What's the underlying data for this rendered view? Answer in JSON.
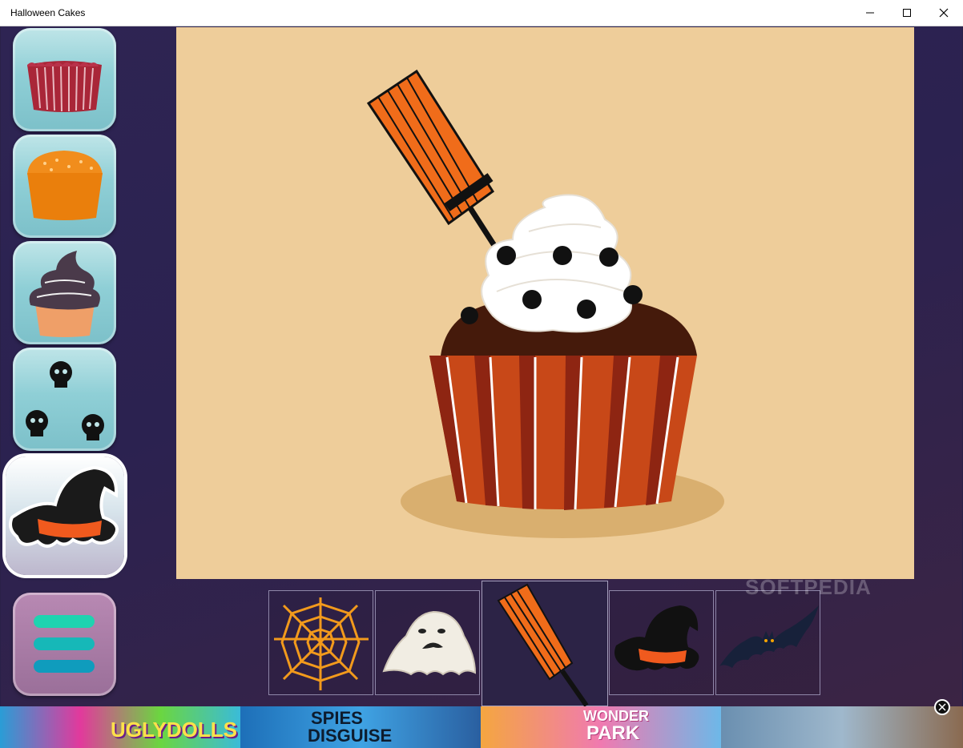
{
  "window": {
    "title": "Halloween Cakes",
    "controls": [
      "minimize-icon",
      "maximize-icon",
      "close-icon"
    ]
  },
  "tools": [
    {
      "name": "cupcake-liner",
      "icon": "liner-icon",
      "selected": false
    },
    {
      "name": "cake-base",
      "icon": "muffin-icon",
      "selected": false
    },
    {
      "name": "frosting",
      "icon": "frosting-icon",
      "selected": false
    },
    {
      "name": "sprinkles",
      "icon": "skulls-icon",
      "selected": false
    },
    {
      "name": "toppers",
      "icon": "witch-hat-icon",
      "selected": true
    }
  ],
  "menu": {
    "icon": "hamburger-icon",
    "colors": [
      "#1fd3b0",
      "#16b8b8",
      "#0f9cbd"
    ]
  },
  "toppers": [
    {
      "name": "spider-web",
      "icon": "spider-web-icon",
      "selected": false
    },
    {
      "name": "ghost",
      "icon": "ghost-icon",
      "selected": false
    },
    {
      "name": "broom",
      "icon": "broom-icon",
      "selected": true
    },
    {
      "name": "witch-hat",
      "icon": "witch-hat-icon",
      "selected": false
    },
    {
      "name": "bat",
      "icon": "bat-icon",
      "selected": false
    }
  ],
  "watermark": "SOFTPEDIA",
  "ads": [
    {
      "text": "UGLYDOLLS"
    },
    {
      "text_top": "SPIES",
      "text_bottom": "DISGUISE"
    },
    {
      "text_top": "WONDER",
      "text_bottom": "PARK"
    },
    {
      "text": ""
    }
  ],
  "colors": {
    "canvas_bg": "#eecd9a",
    "liner_orange": "#c84818",
    "liner_red": "#8e2512",
    "chocolate": "#451a0b",
    "frosting": "#ffffff",
    "broom_orange": "#f06c1a"
  }
}
